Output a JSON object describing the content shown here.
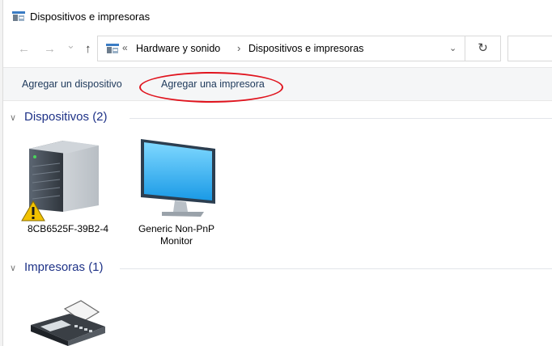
{
  "window": {
    "title": "Dispositivos e impresoras"
  },
  "navigation": {
    "back_glyph": "←",
    "forward_glyph": "→",
    "recent_glyph": "⌄",
    "up_glyph": "↑",
    "breadcrumb_overflow": "«",
    "breadcrumbs": [
      "Hardware y sonido",
      "Dispositivos e impresoras"
    ],
    "separator": "›",
    "dropdown_glyph": "⌄",
    "refresh_glyph": "↻"
  },
  "commands": {
    "add_device": "Agregar un dispositivo",
    "add_printer": "Agregar una impresora"
  },
  "groups": {
    "devices": {
      "header": "Dispositivos (2)",
      "items": [
        {
          "label": "8CB6525F-39B2-4",
          "icon": "server-tower-icon",
          "warning": true
        },
        {
          "label_line1": "Generic Non-PnP",
          "label_line2": "Monitor",
          "icon": "monitor-icon"
        }
      ]
    },
    "printers": {
      "header": "Impresoras (1)",
      "items": [
        {
          "label": "",
          "icon": "fax-printer-icon"
        }
      ]
    }
  },
  "colors": {
    "group_header": "#1e3287",
    "command_text": "#1e395b",
    "highlight_ring": "#e0141e",
    "warning": "#f2c200"
  }
}
